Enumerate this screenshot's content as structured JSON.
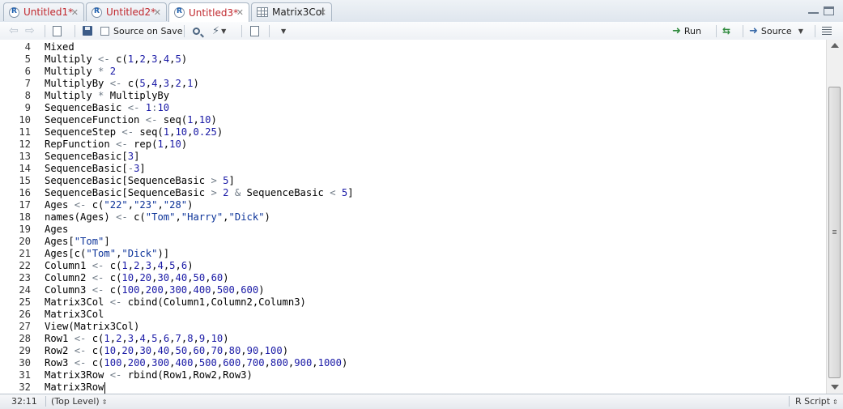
{
  "tabs": [
    {
      "label": "Untitled1*",
      "modified": true,
      "active": false,
      "icon": "r-file-icon"
    },
    {
      "label": "Untitled2*",
      "modified": true,
      "active": false,
      "icon": "r-file-icon"
    },
    {
      "label": "Untitled3*",
      "modified": true,
      "active": true,
      "icon": "r-file-icon"
    },
    {
      "label": "Matrix3Col",
      "modified": false,
      "active": false,
      "icon": "grid-icon"
    }
  ],
  "toolbar": {
    "source_on_save_label": "Source on Save",
    "run_label": "Run",
    "source_label": "Source"
  },
  "editor": {
    "cursor_line": 32,
    "lines": [
      {
        "n": "4",
        "tokens": [
          [
            "t",
            "Mixed"
          ]
        ]
      },
      {
        "n": "5",
        "tokens": [
          [
            "t",
            "Multiply "
          ],
          [
            "o",
            "<-"
          ],
          [
            "t",
            " c("
          ],
          [
            "n",
            "1"
          ],
          [
            "t",
            ","
          ],
          [
            "n",
            "2"
          ],
          [
            "t",
            ","
          ],
          [
            "n",
            "3"
          ],
          [
            "t",
            ","
          ],
          [
            "n",
            "4"
          ],
          [
            "t",
            ","
          ],
          [
            "n",
            "5"
          ],
          [
            "t",
            ")"
          ]
        ]
      },
      {
        "n": "6",
        "tokens": [
          [
            "t",
            "Multiply "
          ],
          [
            "o",
            "*"
          ],
          [
            "t",
            " "
          ],
          [
            "n",
            "2"
          ]
        ]
      },
      {
        "n": "7",
        "tokens": [
          [
            "t",
            "MultiplyBy "
          ],
          [
            "o",
            "<-"
          ],
          [
            "t",
            " c("
          ],
          [
            "n",
            "5"
          ],
          [
            "t",
            ","
          ],
          [
            "n",
            "4"
          ],
          [
            "t",
            ","
          ],
          [
            "n",
            "3"
          ],
          [
            "t",
            ","
          ],
          [
            "n",
            "2"
          ],
          [
            "t",
            ","
          ],
          [
            "n",
            "1"
          ],
          [
            "t",
            ")"
          ]
        ]
      },
      {
        "n": "8",
        "tokens": [
          [
            "t",
            "Multiply "
          ],
          [
            "o",
            "*"
          ],
          [
            "t",
            " MultiplyBy"
          ]
        ]
      },
      {
        "n": "9",
        "tokens": [
          [
            "t",
            "SequenceBasic "
          ],
          [
            "o",
            "<-"
          ],
          [
            "t",
            " "
          ],
          [
            "n",
            "1"
          ],
          [
            "o",
            ":"
          ],
          [
            "n",
            "10"
          ]
        ]
      },
      {
        "n": "10",
        "tokens": [
          [
            "t",
            "SequenceFunction "
          ],
          [
            "o",
            "<-"
          ],
          [
            "t",
            " seq("
          ],
          [
            "n",
            "1"
          ],
          [
            "t",
            ","
          ],
          [
            "n",
            "10"
          ],
          [
            "t",
            ")"
          ]
        ]
      },
      {
        "n": "11",
        "tokens": [
          [
            "t",
            "SequenceStep "
          ],
          [
            "o",
            "<-"
          ],
          [
            "t",
            " seq("
          ],
          [
            "n",
            "1"
          ],
          [
            "t",
            ","
          ],
          [
            "n",
            "10"
          ],
          [
            "t",
            ","
          ],
          [
            "n",
            "0.25"
          ],
          [
            "t",
            ")"
          ]
        ]
      },
      {
        "n": "12",
        "tokens": [
          [
            "t",
            "RepFunction "
          ],
          [
            "o",
            "<-"
          ],
          [
            "t",
            " rep("
          ],
          [
            "n",
            "1"
          ],
          [
            "t",
            ","
          ],
          [
            "n",
            "10"
          ],
          [
            "t",
            ")"
          ]
        ]
      },
      {
        "n": "13",
        "tokens": [
          [
            "t",
            "SequenceBasic["
          ],
          [
            "n",
            "3"
          ],
          [
            "t",
            "]"
          ]
        ]
      },
      {
        "n": "14",
        "tokens": [
          [
            "t",
            "SequenceBasic["
          ],
          [
            "o",
            "-"
          ],
          [
            "n",
            "3"
          ],
          [
            "t",
            "]"
          ]
        ]
      },
      {
        "n": "15",
        "tokens": [
          [
            "t",
            "SequenceBasic[SequenceBasic "
          ],
          [
            "o",
            ">"
          ],
          [
            "t",
            " "
          ],
          [
            "n",
            "5"
          ],
          [
            "t",
            "]"
          ]
        ]
      },
      {
        "n": "16",
        "tokens": [
          [
            "t",
            "SequenceBasic[SequenceBasic "
          ],
          [
            "o",
            ">"
          ],
          [
            "t",
            " "
          ],
          [
            "n",
            "2"
          ],
          [
            "t",
            " "
          ],
          [
            "o",
            "&"
          ],
          [
            "t",
            " SequenceBasic "
          ],
          [
            "o",
            "<"
          ],
          [
            "t",
            " "
          ],
          [
            "n",
            "5"
          ],
          [
            "t",
            "]"
          ]
        ]
      },
      {
        "n": "17",
        "tokens": [
          [
            "t",
            "Ages "
          ],
          [
            "o",
            "<-"
          ],
          [
            "t",
            " c("
          ],
          [
            "s",
            "\"22\""
          ],
          [
            "t",
            ","
          ],
          [
            "s",
            "\"23\""
          ],
          [
            "t",
            ","
          ],
          [
            "s",
            "\"28\""
          ],
          [
            "t",
            ")"
          ]
        ]
      },
      {
        "n": "18",
        "tokens": [
          [
            "t",
            "names(Ages) "
          ],
          [
            "o",
            "<-"
          ],
          [
            "t",
            " c("
          ],
          [
            "s",
            "\"Tom\""
          ],
          [
            "t",
            ","
          ],
          [
            "s",
            "\"Harry\""
          ],
          [
            "t",
            ","
          ],
          [
            "s",
            "\"Dick\""
          ],
          [
            "t",
            ")"
          ]
        ]
      },
      {
        "n": "19",
        "tokens": [
          [
            "t",
            "Ages"
          ]
        ]
      },
      {
        "n": "20",
        "tokens": [
          [
            "t",
            "Ages["
          ],
          [
            "s",
            "\"Tom\""
          ],
          [
            "t",
            "]"
          ]
        ]
      },
      {
        "n": "21",
        "tokens": [
          [
            "t",
            "Ages[c("
          ],
          [
            "s",
            "\"Tom\""
          ],
          [
            "t",
            ","
          ],
          [
            "s",
            "\"Dick\""
          ],
          [
            "t",
            ")]"
          ]
        ]
      },
      {
        "n": "22",
        "tokens": [
          [
            "t",
            "Column1 "
          ],
          [
            "o",
            "<-"
          ],
          [
            "t",
            " c("
          ],
          [
            "n",
            "1"
          ],
          [
            "t",
            ","
          ],
          [
            "n",
            "2"
          ],
          [
            "t",
            ","
          ],
          [
            "n",
            "3"
          ],
          [
            "t",
            ","
          ],
          [
            "n",
            "4"
          ],
          [
            "t",
            ","
          ],
          [
            "n",
            "5"
          ],
          [
            "t",
            ","
          ],
          [
            "n",
            "6"
          ],
          [
            "t",
            ")"
          ]
        ]
      },
      {
        "n": "23",
        "tokens": [
          [
            "t",
            "Column2 "
          ],
          [
            "o",
            "<-"
          ],
          [
            "t",
            " c("
          ],
          [
            "n",
            "10"
          ],
          [
            "t",
            ","
          ],
          [
            "n",
            "20"
          ],
          [
            "t",
            ","
          ],
          [
            "n",
            "30"
          ],
          [
            "t",
            ","
          ],
          [
            "n",
            "40"
          ],
          [
            "t",
            ","
          ],
          [
            "n",
            "50"
          ],
          [
            "t",
            ","
          ],
          [
            "n",
            "60"
          ],
          [
            "t",
            ")"
          ]
        ]
      },
      {
        "n": "24",
        "tokens": [
          [
            "t",
            "Column3 "
          ],
          [
            "o",
            "<-"
          ],
          [
            "t",
            " c("
          ],
          [
            "n",
            "100"
          ],
          [
            "t",
            ","
          ],
          [
            "n",
            "200"
          ],
          [
            "t",
            ","
          ],
          [
            "n",
            "300"
          ],
          [
            "t",
            ","
          ],
          [
            "n",
            "400"
          ],
          [
            "t",
            ","
          ],
          [
            "n",
            "500"
          ],
          [
            "t",
            ","
          ],
          [
            "n",
            "600"
          ],
          [
            "t",
            ")"
          ]
        ]
      },
      {
        "n": "25",
        "tokens": [
          [
            "t",
            "Matrix3Col "
          ],
          [
            "o",
            "<-"
          ],
          [
            "t",
            " cbind(Column1,Column2,Column3)"
          ]
        ]
      },
      {
        "n": "26",
        "tokens": [
          [
            "t",
            "Matrix3Col"
          ]
        ]
      },
      {
        "n": "27",
        "tokens": [
          [
            "t",
            "View(Matrix3Col)"
          ]
        ]
      },
      {
        "n": "28",
        "tokens": [
          [
            "t",
            "Row1 "
          ],
          [
            "o",
            "<-"
          ],
          [
            "t",
            " c("
          ],
          [
            "n",
            "1"
          ],
          [
            "t",
            ","
          ],
          [
            "n",
            "2"
          ],
          [
            "t",
            ","
          ],
          [
            "n",
            "3"
          ],
          [
            "t",
            ","
          ],
          [
            "n",
            "4"
          ],
          [
            "t",
            ","
          ],
          [
            "n",
            "5"
          ],
          [
            "t",
            ","
          ],
          [
            "n",
            "6"
          ],
          [
            "t",
            ","
          ],
          [
            "n",
            "7"
          ],
          [
            "t",
            ","
          ],
          [
            "n",
            "8"
          ],
          [
            "t",
            ","
          ],
          [
            "n",
            "9"
          ],
          [
            "t",
            ","
          ],
          [
            "n",
            "10"
          ],
          [
            "t",
            ")"
          ]
        ]
      },
      {
        "n": "29",
        "tokens": [
          [
            "t",
            "Row2 "
          ],
          [
            "o",
            "<-"
          ],
          [
            "t",
            " c("
          ],
          [
            "n",
            "10"
          ],
          [
            "t",
            ","
          ],
          [
            "n",
            "20"
          ],
          [
            "t",
            ","
          ],
          [
            "n",
            "30"
          ],
          [
            "t",
            ","
          ],
          [
            "n",
            "40"
          ],
          [
            "t",
            ","
          ],
          [
            "n",
            "50"
          ],
          [
            "t",
            ","
          ],
          [
            "n",
            "60"
          ],
          [
            "t",
            ","
          ],
          [
            "n",
            "70"
          ],
          [
            "t",
            ","
          ],
          [
            "n",
            "80"
          ],
          [
            "t",
            ","
          ],
          [
            "n",
            "90"
          ],
          [
            "t",
            ","
          ],
          [
            "n",
            "100"
          ],
          [
            "t",
            ")"
          ]
        ]
      },
      {
        "n": "30",
        "tokens": [
          [
            "t",
            "Row3 "
          ],
          [
            "o",
            "<-"
          ],
          [
            "t",
            " c("
          ],
          [
            "n",
            "100"
          ],
          [
            "t",
            ","
          ],
          [
            "n",
            "200"
          ],
          [
            "t",
            ","
          ],
          [
            "n",
            "300"
          ],
          [
            "t",
            ","
          ],
          [
            "n",
            "400"
          ],
          [
            "t",
            ","
          ],
          [
            "n",
            "500"
          ],
          [
            "t",
            ","
          ],
          [
            "n",
            "600"
          ],
          [
            "t",
            ","
          ],
          [
            "n",
            "700"
          ],
          [
            "t",
            ","
          ],
          [
            "n",
            "800"
          ],
          [
            "t",
            ","
          ],
          [
            "n",
            "900"
          ],
          [
            "t",
            ","
          ],
          [
            "n",
            "1000"
          ],
          [
            "t",
            ")"
          ]
        ]
      },
      {
        "n": "31",
        "tokens": [
          [
            "t",
            "Matrix3Row "
          ],
          [
            "o",
            "<-"
          ],
          [
            "t",
            " rbind(Row1,Row2,Row3)"
          ]
        ]
      },
      {
        "n": "32",
        "tokens": [
          [
            "t",
            "Matrix3Row"
          ]
        ]
      }
    ]
  },
  "status": {
    "position": "32:11",
    "scope": "(Top Level)",
    "file_type": "R Script"
  },
  "colors": {
    "modified_tab": "#c0272d",
    "number": "#1a1aa6",
    "string": "#0c3399",
    "operator": "#6f7a86"
  }
}
